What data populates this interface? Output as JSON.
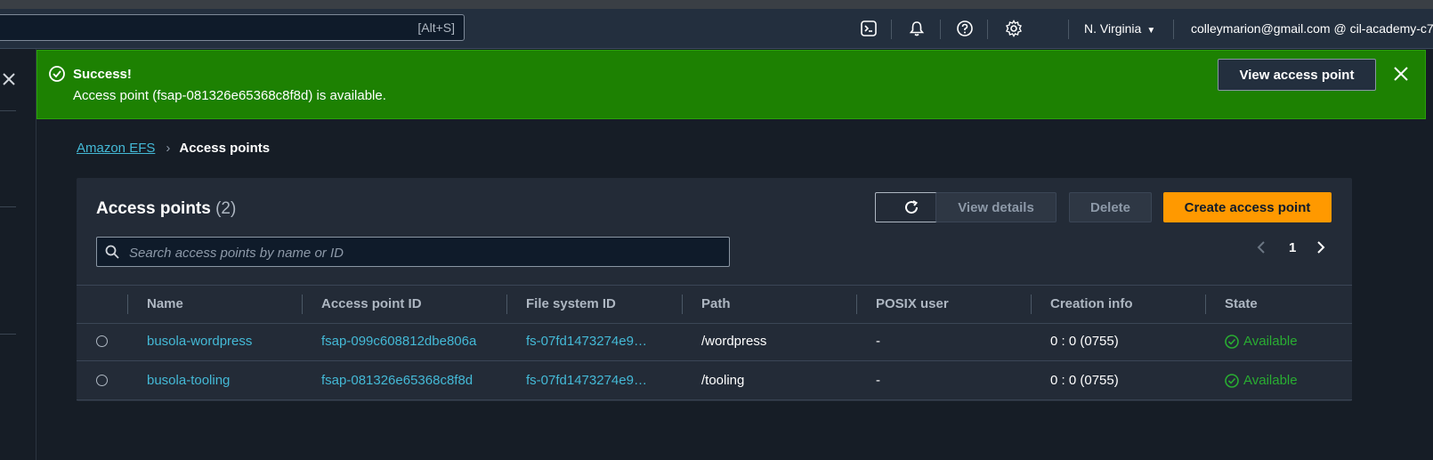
{
  "topnav": {
    "search_shortcut": "[Alt+S]",
    "region": "N. Virginia",
    "account": "colleymarion@gmail.com @ cil-academy-c7",
    "icons": [
      "cloudshell-icon",
      "bell-icon",
      "help-icon",
      "gear-icon"
    ]
  },
  "flash": {
    "title": "Success!",
    "message": "Access point (fsap-081326e65368c8f8d) is available.",
    "action_label": "View access point",
    "color": "#1d8102"
  },
  "breadcrumb": {
    "root": "Amazon EFS",
    "current": "Access points"
  },
  "panel": {
    "title": "Access points",
    "count": "(2)",
    "buttons": {
      "view_details": "View details",
      "delete": "Delete",
      "create": "Create access point"
    },
    "search_placeholder": "Search access points by name or ID",
    "page": "1"
  },
  "table": {
    "columns": [
      "Name",
      "Access point ID",
      "File system ID",
      "Path",
      "POSIX user",
      "Creation info",
      "State"
    ],
    "rows": [
      {
        "name": "busola-wordpress",
        "access_point_id": "fsap-099c608812dbe806a",
        "file_system_id": "fs-07fd1473274e9…",
        "path": "/wordpress",
        "posix_user": "-",
        "creation_info": "0 : 0 (0755)",
        "state": "Available"
      },
      {
        "name": "busola-tooling",
        "access_point_id": "fsap-081326e65368c8f8d",
        "file_system_id": "fs-07fd1473274e9…",
        "path": "/tooling",
        "posix_user": "-",
        "creation_info": "0 : 0 (0755)",
        "state": "Available"
      }
    ]
  },
  "colors": {
    "accent_orange": "#ff9900",
    "link": "#44b9d6",
    "success": "#29ad32"
  }
}
